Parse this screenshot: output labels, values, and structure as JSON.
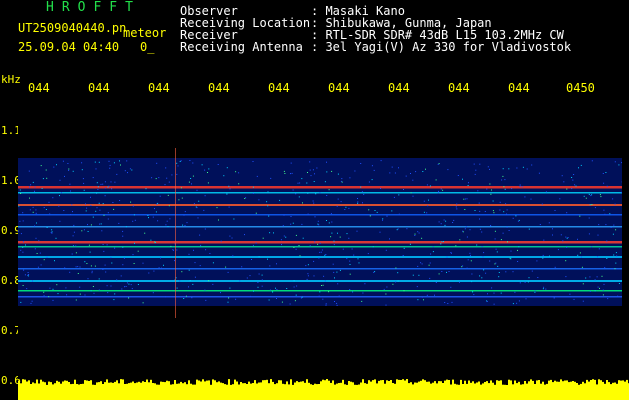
{
  "header": {
    "app_name": "HROFFT",
    "file_name": "UT2509040440.pn",
    "mode": "meteor",
    "datetime": "25.09.04 04:40",
    "count": "0_",
    "observer_label": "Observer",
    "observer_value": ": Masaki Kano",
    "location_label": "Receiving Location",
    "location_value": ": Shibukawa, Gunma, Japan",
    "receiver_label": "Receiver",
    "receiver_value": ": RTL-SDR SDR# 43dB L15 103.2MHz CW",
    "antenna_label": "Receiving Antenna",
    "antenna_value": ": 3el Yagi(V) Az 330 for Vladivostok"
  },
  "time_axis": {
    "labels": [
      "044",
      "044",
      "044",
      "044",
      "044",
      "044",
      "044",
      "044",
      "044",
      "0450"
    ]
  },
  "freq_axis": {
    "unit": "kHz",
    "labels": [
      "1.1",
      "1.0",
      "0.9",
      "0.8",
      "0.7",
      "0.6"
    ]
  },
  "colors": {
    "header_text": "#ffffff",
    "title_green": "#22e04a",
    "axis_yellow": "#ffff00",
    "signal_low": "#000080",
    "signal_mid": "#00c8ff",
    "signal_high": "#ff2020"
  }
}
